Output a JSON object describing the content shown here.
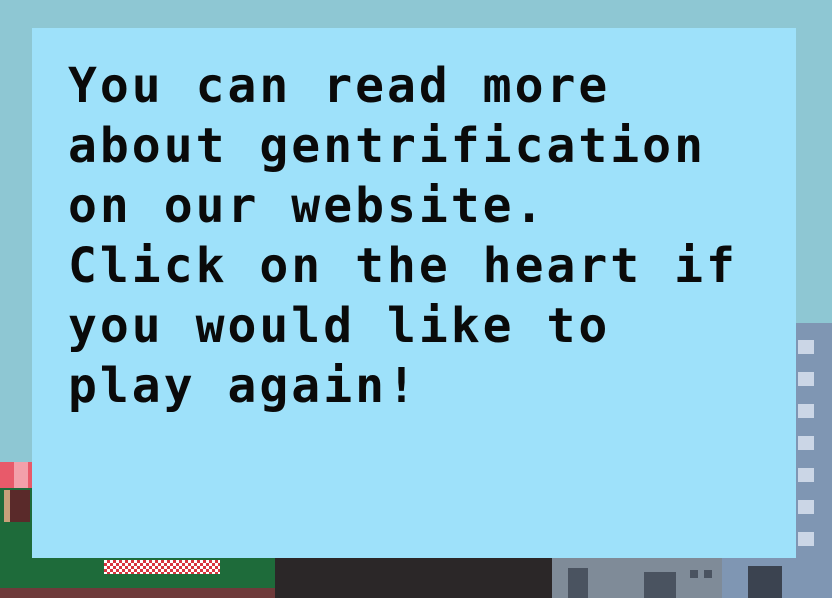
{
  "dialog": {
    "lines": [
      "You can read more",
      "about gentrification",
      "on our website.",
      "Click on the heart if",
      "you would like to",
      "play again!"
    ]
  },
  "colors": {
    "sky": "#8ec7d3",
    "panel": "#9ee1fa",
    "text": "#0a0a0a",
    "shop_green": "#1e6b3a",
    "building_blue": "#7f96b3"
  }
}
